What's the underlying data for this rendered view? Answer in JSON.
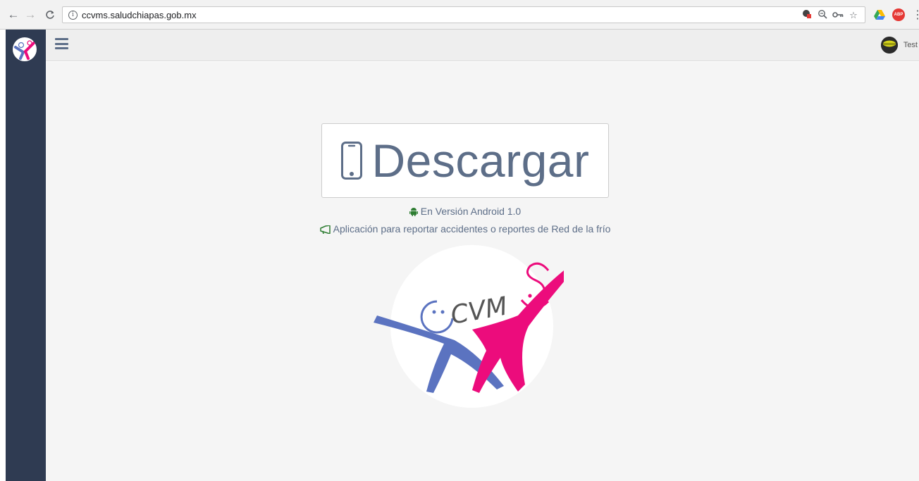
{
  "browser": {
    "url": "ccvms.saludchiapas.gob.mx",
    "info_glyph": "i",
    "icons": [
      "back-arrow-icon",
      "forward-arrow-icon",
      "reload-icon",
      "info-icon",
      "blocked-popup-icon",
      "zoom-icon",
      "key-icon",
      "star-icon",
      "drive-icon",
      "adblock-icon",
      "menu-kebab-icon"
    ],
    "abp_label": "ABP"
  },
  "sidebar": {
    "logo": "ccvms-logo"
  },
  "topbar": {
    "user_name": "Test"
  },
  "main": {
    "download_label": "Descargar",
    "version_text": "En Versión Android 1.0",
    "description_text": "Aplicación para reportar accidentes o reportes de Red de la frío",
    "logo_text": "CVM",
    "colors": {
      "accent": "#5d6e88",
      "sidebar": "#2f3b52",
      "blue_figure": "#5b73c0",
      "pink_figure": "#ec0c7c",
      "android_green": "#2e7d32"
    }
  }
}
